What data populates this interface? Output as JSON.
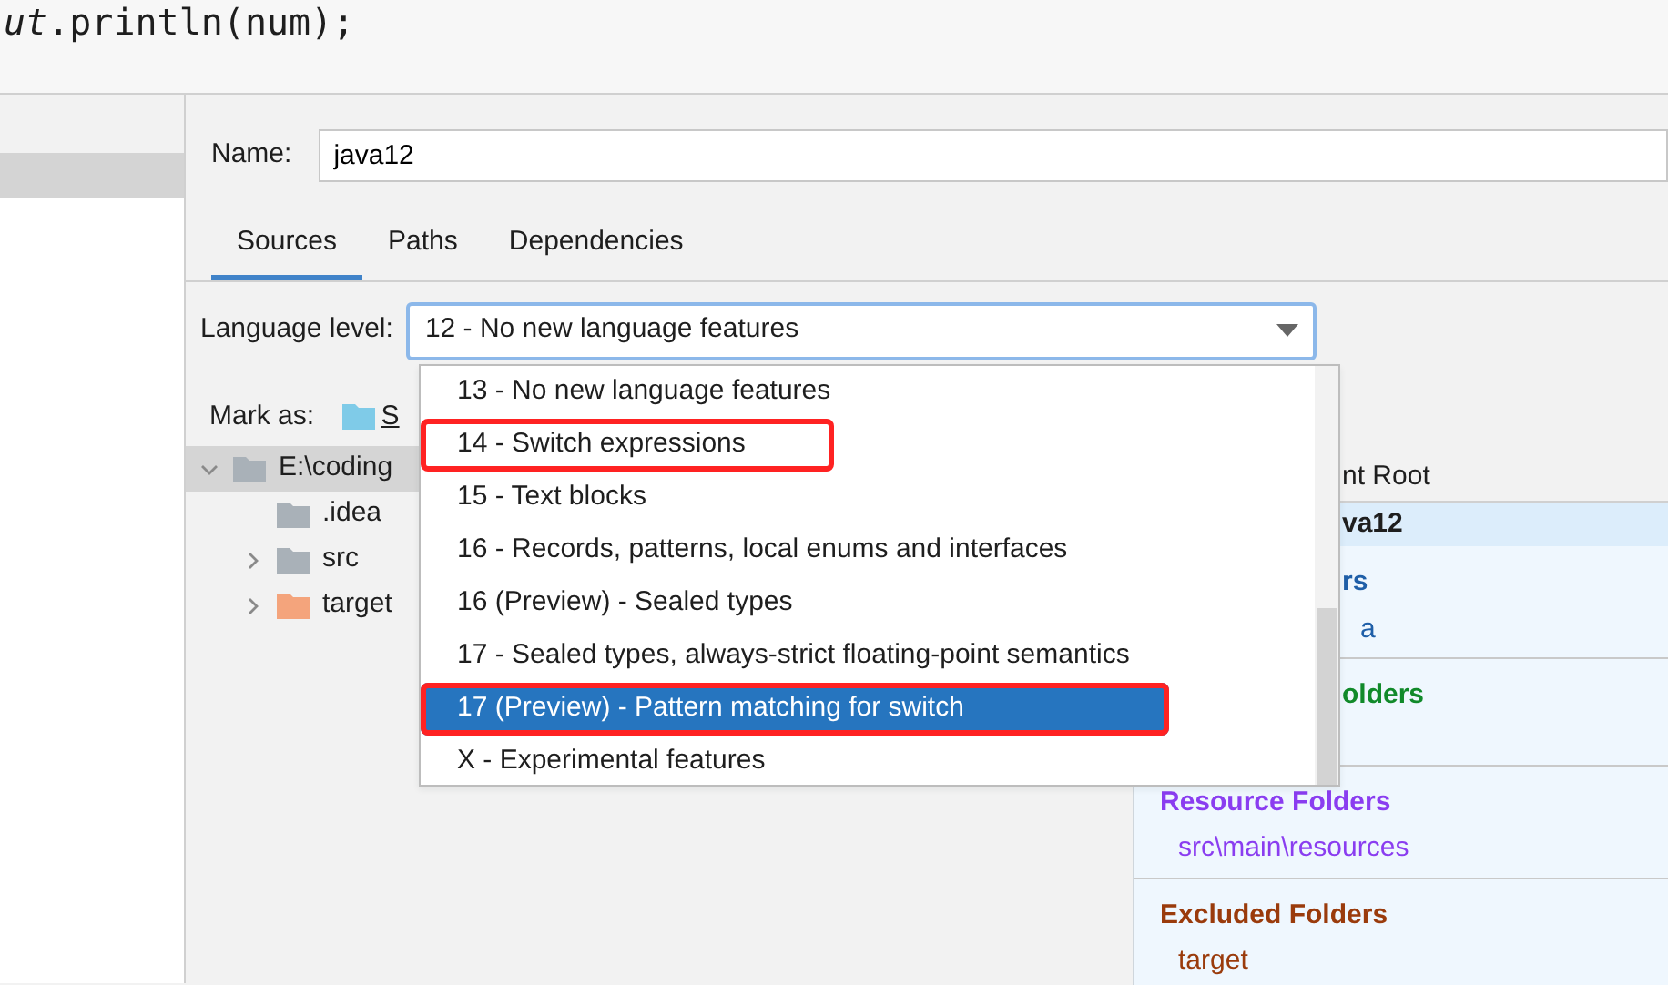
{
  "editor_line": "*ut*.println(num);",
  "name_field": {
    "label": "Name:",
    "value": "java12"
  },
  "tabs": [
    {
      "label": "Sources",
      "selected": true
    },
    {
      "label": "Paths",
      "selected": false
    },
    {
      "label": "Dependencies",
      "selected": false
    }
  ],
  "language_level": {
    "label": "Language level:",
    "value": "12 - No new language features"
  },
  "mark_as": {
    "label": "Mark as:",
    "button": "S"
  },
  "tree": [
    {
      "label": "E:\\coding",
      "expanded": true,
      "selected": true,
      "color": "#a9b1b8",
      "children": [
        {
          "label": ".idea",
          "color": "#a9b1b8"
        },
        {
          "label": "src",
          "expanded": false,
          "color": "#a9b1b8"
        },
        {
          "label": "target",
          "expanded": false,
          "color": "#f4a47c"
        }
      ]
    }
  ],
  "content_root": {
    "header": "nt Root",
    "name": "va12",
    "sections": [
      {
        "title": "rs",
        "color": "#1f5fa8",
        "covered": true,
        "items": [
          "a"
        ]
      },
      {
        "title": "olders",
        "color": "#118a2a",
        "covered": true
      },
      {
        "title": "Resource Folders",
        "color": "#8a3df0",
        "covered": false,
        "items": [
          "src\\main\\resources"
        ]
      },
      {
        "title": "Excluded Folders",
        "color": "#9a3b0c",
        "covered": false,
        "items": [
          "target"
        ]
      }
    ]
  },
  "dropdown": [
    {
      "label": "13 - No new language features",
      "selected": false,
      "highlighted": false
    },
    {
      "label": "14 - Switch expressions",
      "selected": false,
      "highlighted": true
    },
    {
      "label": "15 - Text blocks",
      "selected": false,
      "highlighted": false
    },
    {
      "label": "16 - Records, patterns, local enums and interfaces",
      "selected": false,
      "highlighted": false
    },
    {
      "label": "16 (Preview) - Sealed types",
      "selected": false,
      "highlighted": false
    },
    {
      "label": "17 - Sealed types, always-strict floating-point semantics",
      "selected": false,
      "highlighted": false
    },
    {
      "label": "17 (Preview) - Pattern matching for switch",
      "selected": true,
      "highlighted": true
    },
    {
      "label": "X - Experimental features",
      "selected": false,
      "highlighted": false
    }
  ]
}
